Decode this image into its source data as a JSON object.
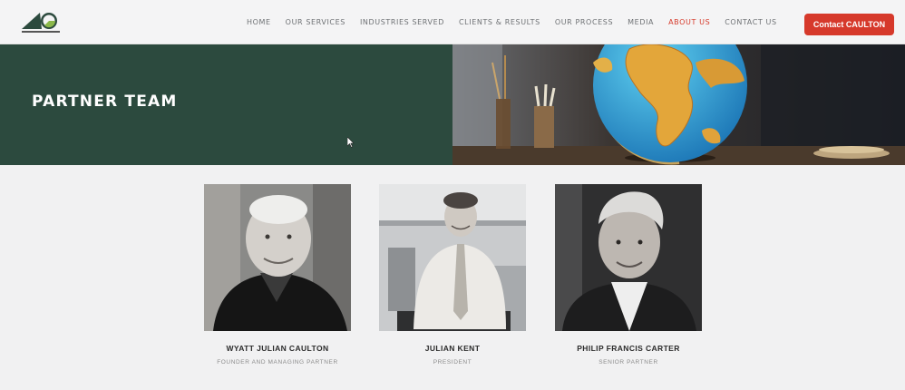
{
  "header": {
    "logo_icon": "caulton-logo",
    "nav": [
      {
        "label": "HOME",
        "active": false
      },
      {
        "label": "OUR SERVICES",
        "active": false
      },
      {
        "label": "INDUSTRIES SERVED",
        "active": false
      },
      {
        "label": "CLIENTS & RESULTS",
        "active": false
      },
      {
        "label": "OUR PROCESS",
        "active": false
      },
      {
        "label": "MEDIA",
        "active": false
      },
      {
        "label": "ABOUT US",
        "active": true
      },
      {
        "label": "CONTACT US",
        "active": false
      }
    ],
    "cta_label": "Contact CAULTON"
  },
  "hero": {
    "title": "PARTNER TEAM",
    "image_icon": "globe-desk-photo"
  },
  "team": [
    {
      "name": "WYATT JULIAN CAULTON",
      "role": "FOUNDER AND MANAGING PARTNER"
    },
    {
      "name": "JULIAN KENT",
      "role": "PRESIDENT"
    },
    {
      "name": "PHILIP FRANCIS CARTER",
      "role": "SENIOR PARTNER"
    }
  ],
  "colors": {
    "brand_green": "#2c4a3e",
    "accent_red": "#d6392b",
    "page_bg": "#f1f1f2"
  }
}
